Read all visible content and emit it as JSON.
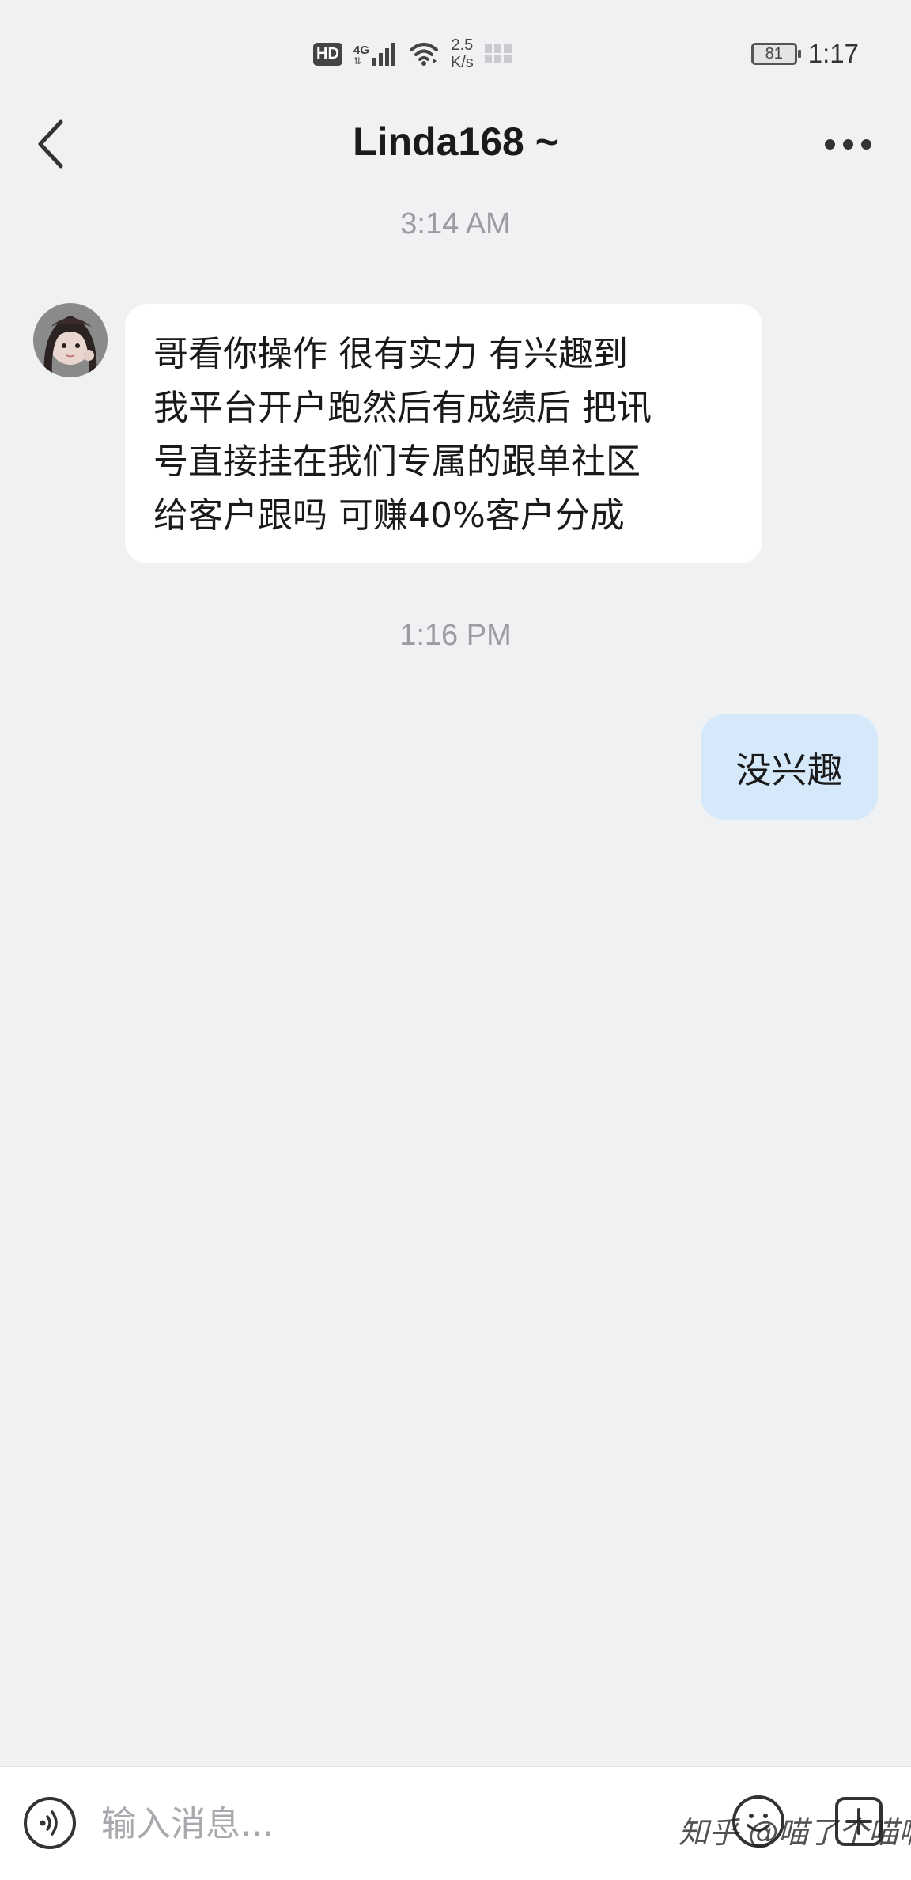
{
  "status_bar": {
    "hd": "HD",
    "network": "4G",
    "speed_value": "2.5",
    "speed_unit": "K/s",
    "battery": "81",
    "time": "1:17"
  },
  "header": {
    "title": "Linda168 ~",
    "back_icon": "chevron-left-icon",
    "more_icon": "more-horizontal-icon"
  },
  "messages": [
    {
      "type": "timestamp",
      "text": "3:14 AM"
    },
    {
      "type": "incoming",
      "text": "哥看你操作 很有实力 有兴趣到\n我平台开户跑然后有成绩后 把讯\n号直接挂在我们专属的跟单社区\n给客户跟吗 可赚40%客户分成"
    },
    {
      "type": "timestamp",
      "text": "1:16 PM"
    },
    {
      "type": "outgoing",
      "text": "没兴趣"
    }
  ],
  "input_bar": {
    "placeholder": "输入消息...",
    "voice_icon": "voice-icon",
    "emoji_icon": "emoji-icon",
    "plus_icon": "plus-icon"
  },
  "watermark": "知乎 @喵了个喵啊",
  "colors": {
    "background": "#f0f1f3",
    "incoming_bubble": "#ffffff",
    "outgoing_bubble": "#d5e9fb",
    "timestamp": "#9a9ca0"
  }
}
